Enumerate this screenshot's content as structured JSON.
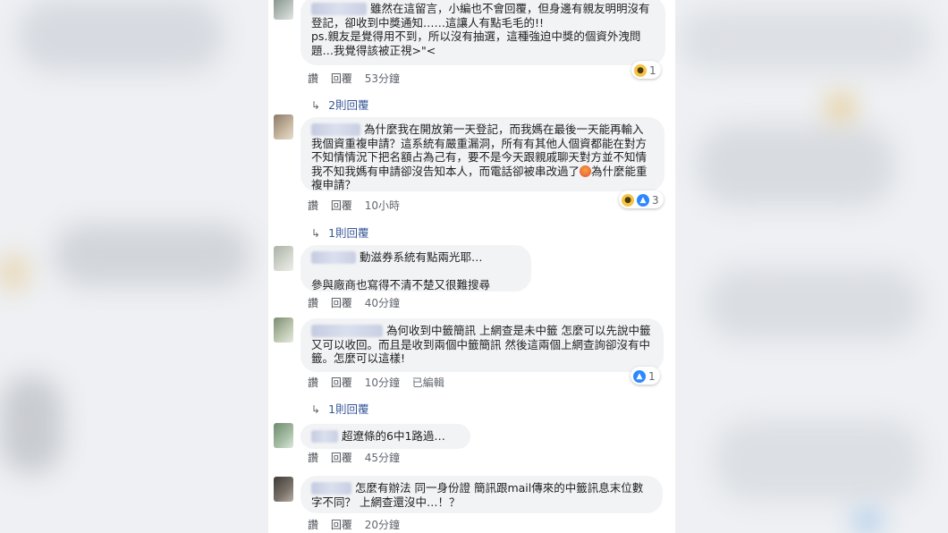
{
  "comments": [
    {
      "text": "雖然在這留言，小編也不會回覆，但身邊有親友明明沒有登記，卻收到中獎通知……這讓人有點毛毛的!!\nps.親友是覺得用不到，所以沒有抽選，這種強迫中獎的個資外洩問題…我覺得該被正視>\"<",
      "actions": {
        "like": "讚",
        "reply": "回覆",
        "time": "53分鐘"
      },
      "reactions": {
        "count": "1",
        "icons": [
          "wow-icon"
        ]
      },
      "replies_link": "2則回覆"
    },
    {
      "text": "為什麼我在開放第一天登記，而我媽在最後一天能再輸入我個資重複申請？這系統有嚴重漏洞，所有有其他人個資都能在對方不知情情況下把名額占為己有，要不是今天跟親戚聊天對方並不知情我不知我媽有申請卻沒告知本人，而電話卻被串改過了",
      "text_tail": "為什麼能重複申請？",
      "actions": {
        "like": "讚",
        "reply": "回覆",
        "time": "10小時"
      },
      "reactions": {
        "count": "3",
        "icons": [
          "wow-icon",
          "like-icon"
        ]
      },
      "replies_link": "1則回覆"
    },
    {
      "text": "動滋券系統有點兩光耶…\n\n參與廠商也寫得不清不楚又很難搜尋",
      "actions": {
        "like": "讚",
        "reply": "回覆",
        "time": "40分鐘"
      }
    },
    {
      "text": "為何收到中籤簡訊 上網查是未中籤 怎麼可以先說中籤 又可以收回。而且是收到兩個中籤簡訊 然後這兩個上網查詢卻沒有中籤。怎麼可以這樣!",
      "actions": {
        "like": "讚",
        "reply": "回覆",
        "time": "10分鐘",
        "edited": "已編輯"
      },
      "reactions": {
        "count": "1",
        "icons": [
          "like-icon"
        ]
      },
      "replies_link": "1則回覆"
    },
    {
      "text": "超遼條的6中1路過…",
      "actions": {
        "like": "讚",
        "reply": "回覆",
        "time": "45分鐘"
      }
    },
    {
      "text": "怎麼有辦法 同一身份證 簡訊跟mail傳來的中籤訊息末位數字不同？ 上網查還沒中…！？",
      "actions": {
        "like": "讚",
        "reply": "回覆",
        "time": "20分鐘"
      }
    }
  ],
  "colors": {
    "bubble": "#f2f3f5",
    "link": "#385898",
    "meta": "#616770",
    "like": "#2d88ff",
    "wow": "#f6c445"
  }
}
